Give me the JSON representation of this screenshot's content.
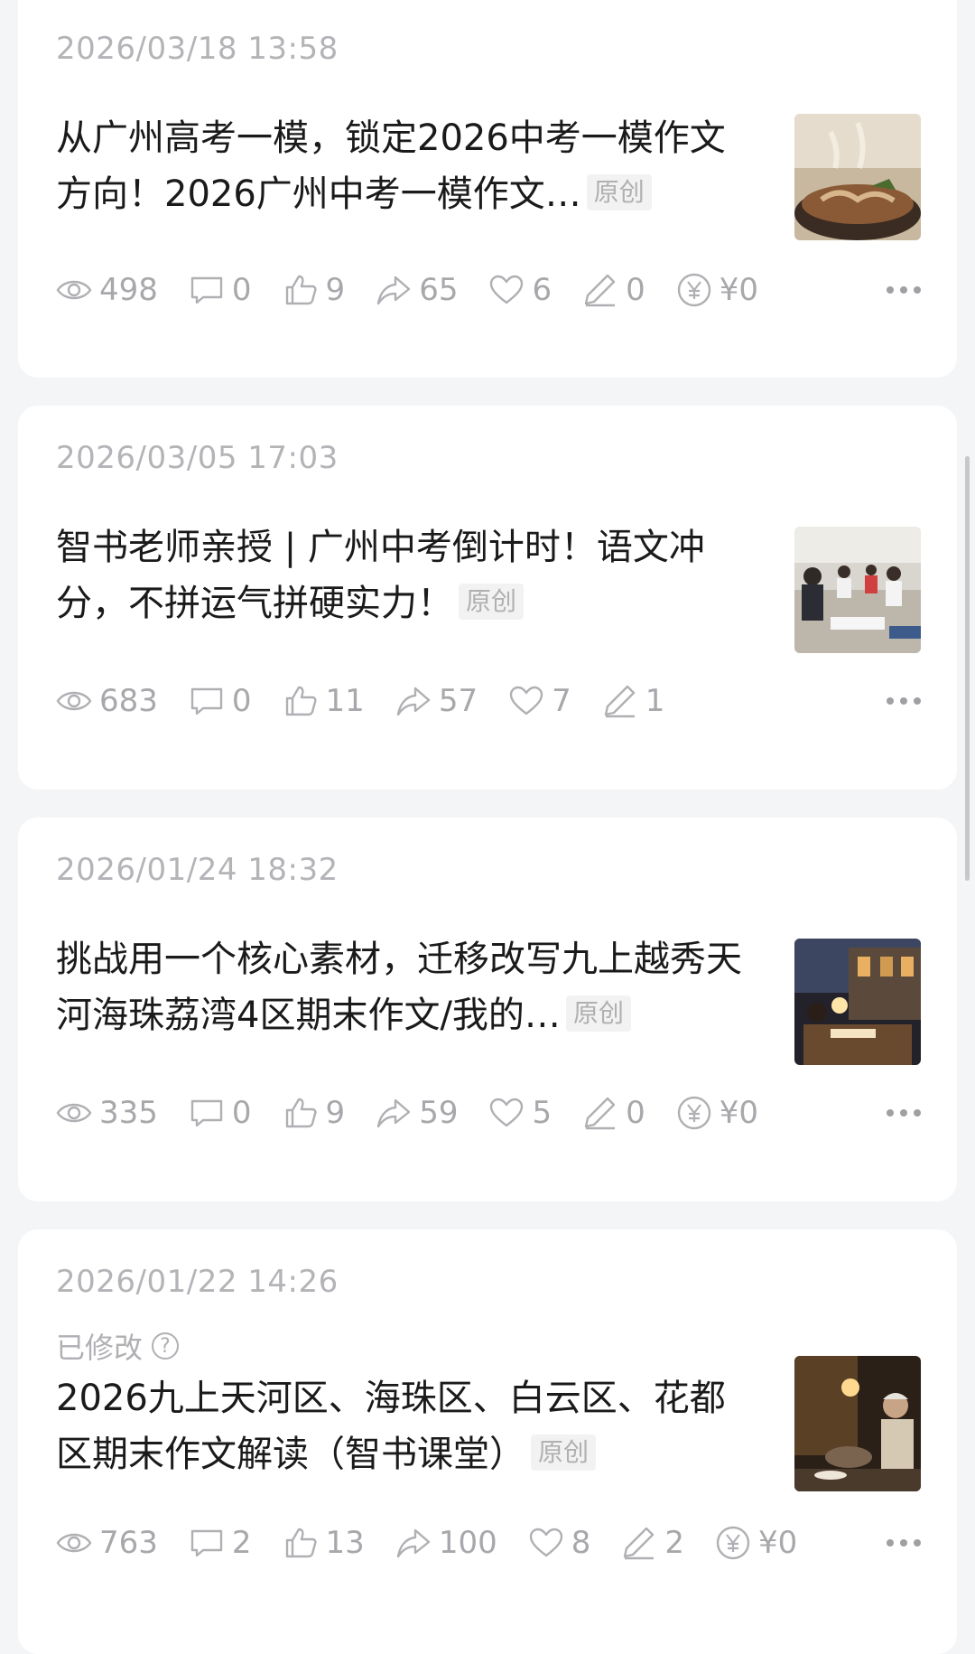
{
  "articles": [
    {
      "date": "2026/03/18 13:58",
      "title": "从广州高考一模，锁定2026中考一模作文方向！2026广州中考一模作文…",
      "badge": "原创",
      "thumb": "food-soup-image",
      "views": "498",
      "comments": "0",
      "likes": "9",
      "shares": "65",
      "favorites": "6",
      "notes": "0",
      "reward": "¥0"
    },
    {
      "date": "2026/03/05 17:03",
      "title": "智书老师亲授 | 广州中考倒计时！语文冲分，不拼运气拼硬实力！",
      "badge": "原创",
      "thumb": "classroom-image",
      "views": "683",
      "comments": "0",
      "likes": "11",
      "shares": "57",
      "favorites": "7",
      "notes": "1"
    },
    {
      "date": "2026/01/24 18:32",
      "title": "挑战用一个核心素材，迁移改写九上越秀天河海珠荔湾4区期末作文/我的…",
      "badge": "原创",
      "thumb": "night-study-image",
      "views": "335",
      "comments": "0",
      "likes": "9",
      "shares": "59",
      "favorites": "5",
      "notes": "0",
      "reward": "¥0"
    },
    {
      "date": "2026/01/22 14:26",
      "modified": "已修改",
      "title": "2026九上天河区、海珠区、白云区、花都区期末作文解读（智书课堂）",
      "badge": "原创",
      "thumb": "elderly-cooking-image",
      "views": "763",
      "comments": "2",
      "likes": "13",
      "shares": "100",
      "favorites": "8",
      "notes": "2",
      "reward": "¥0"
    }
  ]
}
